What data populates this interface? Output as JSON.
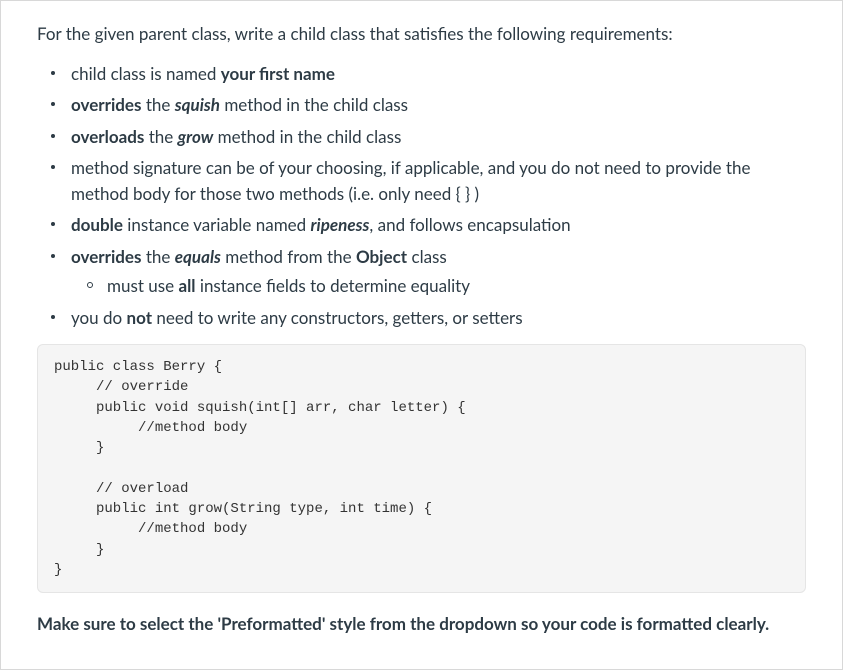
{
  "intro": "For the given parent class, write a child class that satisfies the following requirements:",
  "req": {
    "r0": {
      "t0": "child class is named ",
      "b0": "your first name"
    },
    "r1": {
      "b0": "overrides",
      "t0": " the ",
      "bi0": "squish",
      "t1": " method in the child class"
    },
    "r2": {
      "b0": "overloads",
      "t0": " the ",
      "bi0": "grow",
      "t1": " method in the child class"
    },
    "r3": {
      "t0": "method signature can be of your choosing, if applicable, and you do not need to provide the method body for those two methods (i.e. only need { } )"
    },
    "r4": {
      "b0": "double",
      "t0": " instance variable named ",
      "bi0": "ripeness",
      "t1": ", and follows encapsulation"
    },
    "r5": {
      "b0": "overrides",
      "t0": " the ",
      "bi0": "equals",
      "t1": " method from the ",
      "b1": "Object",
      "t2": " class"
    },
    "r5sub": {
      "t0": "must use ",
      "b0": "all",
      "t1": " instance fields to determine equality"
    },
    "r6": {
      "t0": "you do ",
      "b0": "not",
      "t1": " need to write any constructors, getters, or setters"
    }
  },
  "code": "public class Berry {\n     // override\n     public void squish(int[] arr, char letter) {\n          //method body\n     }\n\n     // overload\n     public int grow(String type, int time) {\n          //method body\n     }\n}",
  "footer": "Make sure to select the 'Preformatted' style from the dropdown so your code is formatted clearly."
}
